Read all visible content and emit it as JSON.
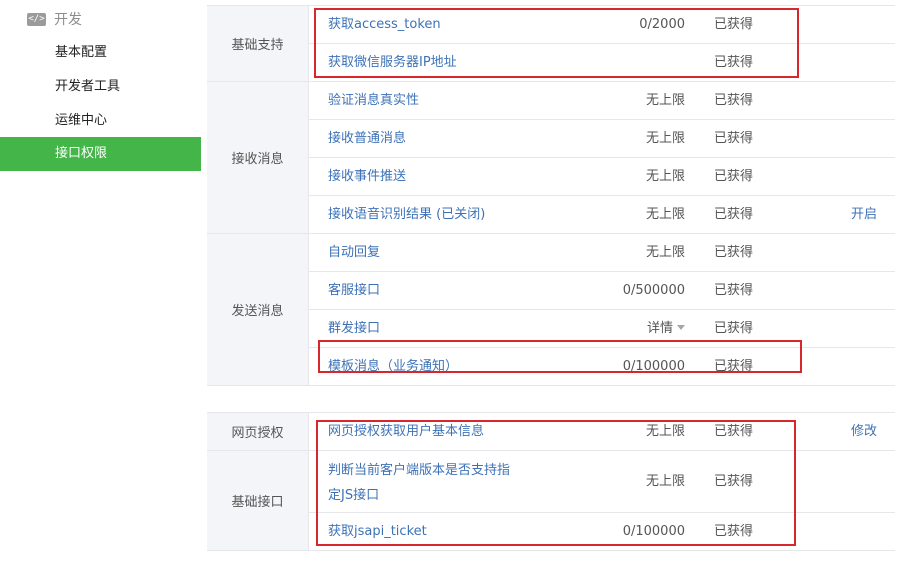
{
  "sidebar": {
    "section_icon": "code-icon",
    "section_icon_glyph": "</>",
    "section_title": "开发",
    "items": [
      {
        "label": "基本配置",
        "active": false
      },
      {
        "label": "开发者工具",
        "active": false
      },
      {
        "label": "运维中心",
        "active": false
      },
      {
        "label": "接口权限",
        "active": true
      }
    ]
  },
  "colors": {
    "accent": "#44b549",
    "link": "#3d72b7",
    "highlight": "#d9262c"
  },
  "table1": {
    "groups": [
      {
        "label": "基础支持",
        "rows": [
          {
            "name": "获取access_token",
            "limit": "0/2000",
            "status": "已获得",
            "action": ""
          },
          {
            "name": "获取微信服务器IP地址",
            "limit": "",
            "status": "已获得",
            "action": ""
          }
        ]
      },
      {
        "label": "接收消息",
        "rows": [
          {
            "name": "验证消息真实性",
            "limit": "无上限",
            "status": "已获得",
            "action": ""
          },
          {
            "name": "接收普通消息",
            "limit": "无上限",
            "status": "已获得",
            "action": ""
          },
          {
            "name": "接收事件推送",
            "limit": "无上限",
            "status": "已获得",
            "action": ""
          },
          {
            "name": "接收语音识别结果 (已关闭)",
            "limit": "无上限",
            "status": "已获得",
            "action": "开启"
          }
        ]
      },
      {
        "label": "发送消息",
        "rows": [
          {
            "name": "自动回复",
            "limit": "无上限",
            "status": "已获得",
            "action": ""
          },
          {
            "name": "客服接口",
            "limit": "0/500000",
            "status": "已获得",
            "action": ""
          },
          {
            "name": "群发接口",
            "limit": "详情",
            "status": "已获得",
            "action": ""
          },
          {
            "name": "模板消息（业务通知）",
            "limit": "0/100000",
            "status": "已获得",
            "action": ""
          }
        ]
      }
    ]
  },
  "table2": {
    "groups": [
      {
        "label": "网页授权",
        "rows": [
          {
            "name": "网页授权获取用户基本信息",
            "limit": "无上限",
            "status": "已获得",
            "action": "修改"
          }
        ]
      },
      {
        "label": "基础接口",
        "rows": [
          {
            "name": "判断当前客户端版本是否支持指定JS接口",
            "limit": "无上限",
            "status": "已获得",
            "action": ""
          },
          {
            "name": "获取jsapi_ticket",
            "limit": "0/100000",
            "status": "已获得",
            "action": ""
          }
        ]
      }
    ]
  }
}
